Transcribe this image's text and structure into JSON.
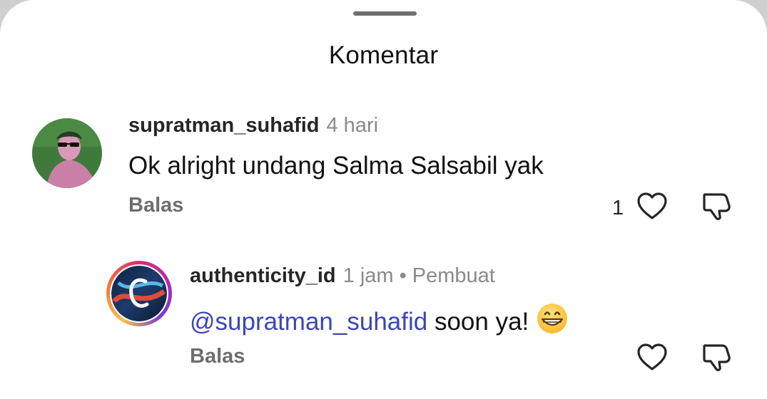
{
  "sheet": {
    "title": "Komentar"
  },
  "comments": [
    {
      "username": "supratman_suhafid",
      "time": "4 hari",
      "text": "Ok alright undang Salma Salsabil yak",
      "reply_label": "Balas",
      "like_count": "1"
    },
    {
      "username": "authenticity_id",
      "time": "1 jam",
      "separator": "•",
      "creator_label": "Pembuat",
      "mention": "@supratman_suhafid",
      "text": " soon ya!",
      "reply_label": "Balas",
      "avatar_letter": "C"
    }
  ],
  "colors": {
    "mention": "#3b46b5",
    "muted": "#8a8a8a"
  }
}
